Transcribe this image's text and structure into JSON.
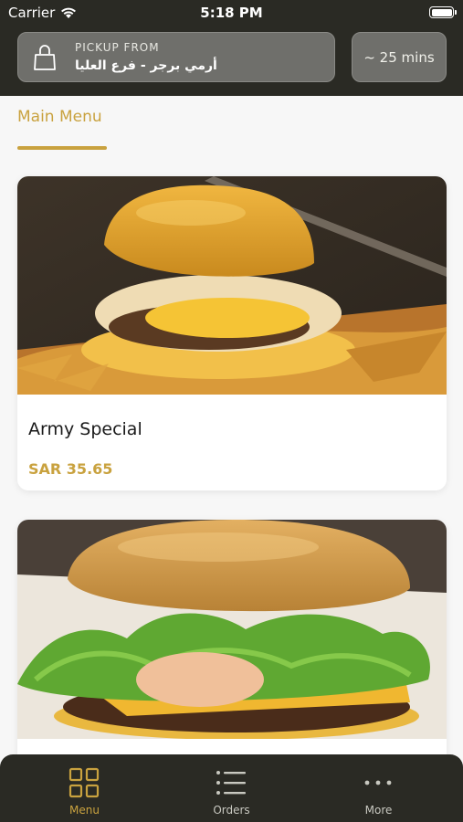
{
  "status_bar": {
    "carrier": "Carrier",
    "time": "5:18 PM"
  },
  "header": {
    "pickup_label": "PICKUP FROM",
    "pickup_location": "أرمي برجر - فرع العليا",
    "wait_time": "~ 25 mins",
    "bag_icon": "shopping-bag-icon"
  },
  "menu": {
    "active_tab": "Main Menu",
    "items": [
      {
        "name": "Army Special",
        "price": "SAR 35.65"
      },
      {
        "name": "",
        "price": ""
      }
    ]
  },
  "tabbar": {
    "items": [
      {
        "label": "Menu",
        "icon": "grid-icon",
        "active": true
      },
      {
        "label": "Orders",
        "icon": "list-icon",
        "active": false
      },
      {
        "label": "More",
        "icon": "more-dots-icon",
        "active": false
      }
    ]
  },
  "colors": {
    "accent": "#c9a23f",
    "header_bg": "#2a2a24",
    "card_bg": "#6f6f6b"
  }
}
